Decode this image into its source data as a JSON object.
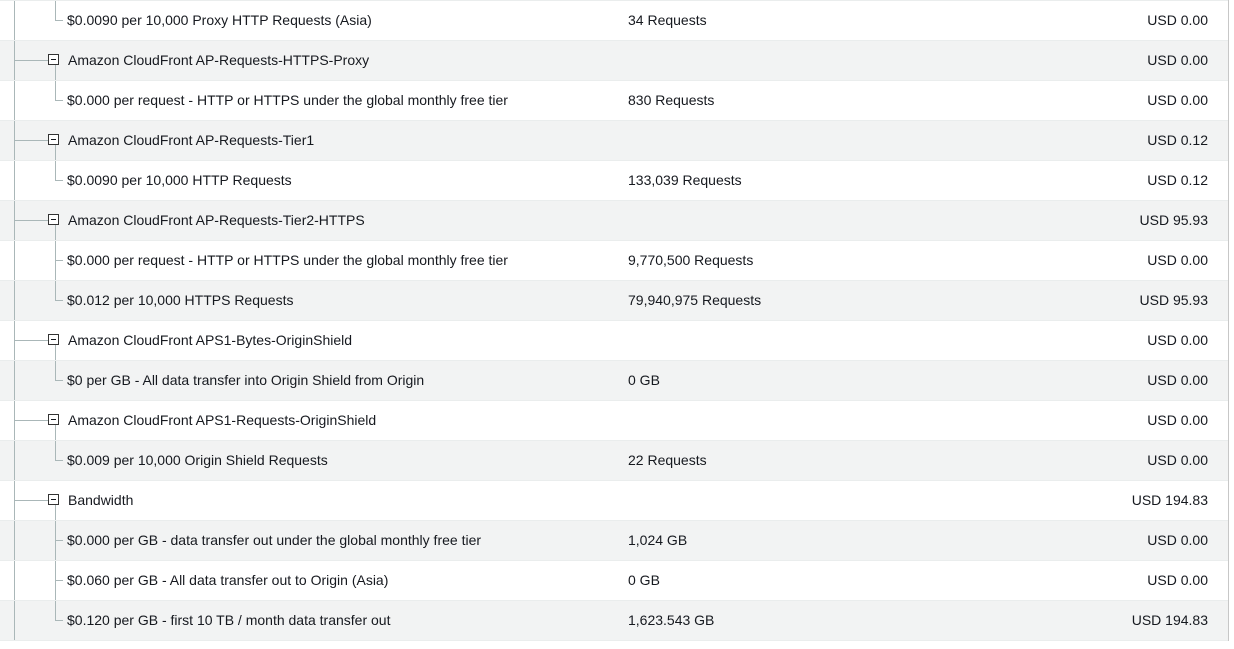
{
  "rows": [
    {
      "type": "item",
      "desc": "$0.0090 per 10,000 Proxy HTTP Requests (Asia)",
      "qty": "34 Requests",
      "amount": "USD 0.00"
    },
    {
      "type": "group",
      "desc": "Amazon CloudFront AP-Requests-HTTPS-Proxy",
      "qty": "",
      "amount": "USD 0.00"
    },
    {
      "type": "item",
      "desc": "$0.000 per request - HTTP or HTTPS under the global monthly free tier",
      "qty": "830 Requests",
      "amount": "USD 0.00"
    },
    {
      "type": "group",
      "desc": "Amazon CloudFront AP-Requests-Tier1",
      "qty": "",
      "amount": "USD 0.12"
    },
    {
      "type": "item",
      "desc": "$0.0090 per 10,000 HTTP Requests",
      "qty": "133,039 Requests",
      "amount": "USD 0.12"
    },
    {
      "type": "group",
      "desc": "Amazon CloudFront AP-Requests-Tier2-HTTPS",
      "qty": "",
      "amount": "USD 95.93"
    },
    {
      "type": "item",
      "desc": "$0.000 per request - HTTP or HTTPS under the global monthly free tier",
      "qty": "9,770,500 Requests",
      "amount": "USD 0.00"
    },
    {
      "type": "item",
      "desc": "$0.012 per 10,000 HTTPS Requests",
      "qty": "79,940,975 Requests",
      "amount": "USD 95.93"
    },
    {
      "type": "group",
      "desc": "Amazon CloudFront APS1-Bytes-OriginShield",
      "qty": "",
      "amount": "USD 0.00"
    },
    {
      "type": "item",
      "desc": "$0 per GB - All data transfer into Origin Shield from Origin",
      "qty": "0 GB",
      "amount": "USD 0.00"
    },
    {
      "type": "group",
      "desc": "Amazon CloudFront APS1-Requests-OriginShield",
      "qty": "",
      "amount": "USD 0.00"
    },
    {
      "type": "item",
      "desc": "$0.009 per 10,000 Origin Shield Requests",
      "qty": "22 Requests",
      "amount": "USD 0.00"
    },
    {
      "type": "group",
      "desc": "Bandwidth",
      "qty": "",
      "amount": "USD 194.83"
    },
    {
      "type": "item",
      "desc": "$0.000 per GB - data transfer out under the global monthly free tier",
      "qty": "1,024 GB",
      "amount": "USD 0.00"
    },
    {
      "type": "item",
      "desc": "$0.060 per GB - All data transfer out to Origin (Asia)",
      "qty": "0 GB",
      "amount": "USD 0.00"
    },
    {
      "type": "item",
      "desc": "$0.120 per GB - first 10 TB / month data transfer out",
      "qty": "1,623.543 GB",
      "amount": "USD 194.83"
    }
  ],
  "icons": {
    "group_toggle": "collapse-minus-icon"
  }
}
